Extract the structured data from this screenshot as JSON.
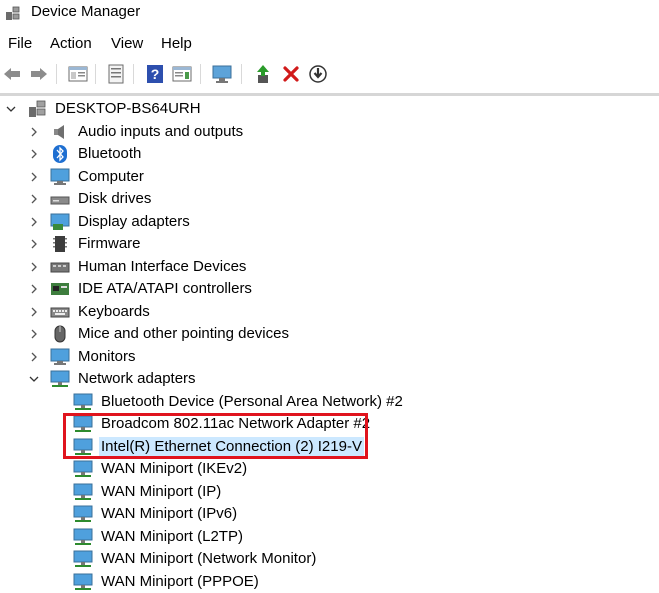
{
  "window": {
    "title": "Device Manager"
  },
  "menu": {
    "file": "File",
    "action": "Action",
    "view": "View",
    "help": "Help"
  },
  "toolbar": {
    "icons": [
      "back-icon",
      "forward-icon",
      "show-hide-console-tree-icon",
      "properties-icon",
      "help-icon",
      "show-action-pane-icon",
      "scan-hardware-changes-icon",
      "update-driver-icon",
      "uninstall-icon",
      "disable-device-icon"
    ]
  },
  "tree": {
    "root": "DESKTOP-BS64URH",
    "categories": [
      "Audio inputs and outputs",
      "Bluetooth",
      "Computer",
      "Disk drives",
      "Display adapters",
      "Firmware",
      "Human Interface Devices",
      "IDE ATA/ATAPI controllers",
      "Keyboards",
      "Mice and other pointing devices",
      "Monitors",
      "Network adapters"
    ],
    "network_adapters": [
      "Bluetooth Device (Personal Area Network) #2",
      "Broadcom 802.11ac Network Adapter #2",
      "Intel(R) Ethernet Connection (2) I219-V",
      "WAN Miniport (IKEv2)",
      "WAN Miniport (IP)",
      "WAN Miniport (IPv6)",
      "WAN Miniport (L2TP)",
      "WAN Miniport (Network Monitor)",
      "WAN Miniport (PPPOE)"
    ],
    "selected": "Intel(R) Ethernet Connection (2) I219-V"
  },
  "colors": {
    "highlight_box": "#e0141e",
    "selection": "#cce8ff"
  }
}
